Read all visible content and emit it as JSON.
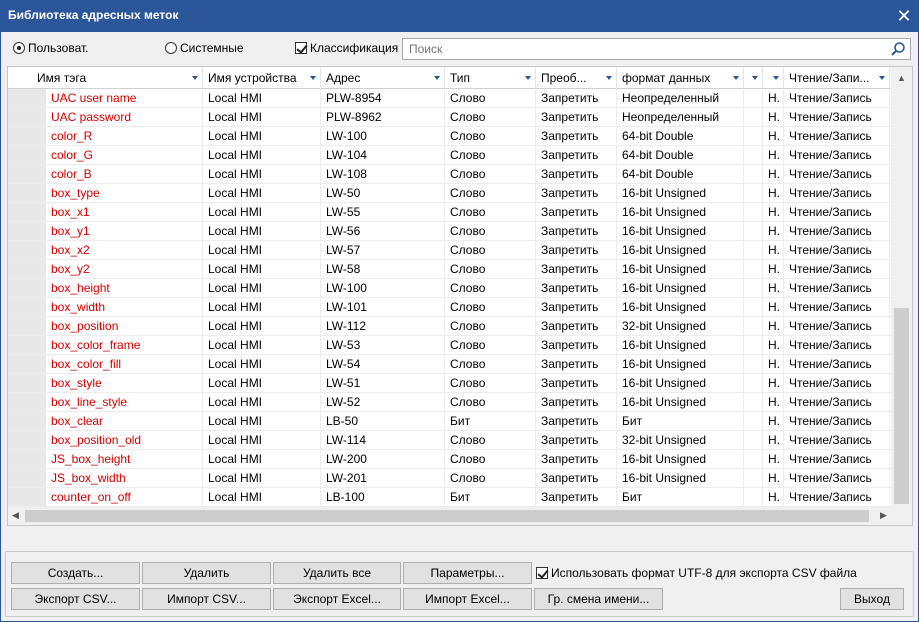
{
  "window": {
    "title": "Библиотека адресных меток",
    "close_glyph": "✕"
  },
  "filters": {
    "user_label": "Пользоват.",
    "system_label": "Системные",
    "classification_label": "Классификация",
    "user_selected": true,
    "classification_checked": true,
    "search_placeholder": "Поиск"
  },
  "table": {
    "columns": [
      "Имя тэга",
      "Имя устройства",
      "Адрес",
      "Тип",
      "Преоб...",
      "формат данных",
      "",
      "",
      "Чтение/Запи..."
    ],
    "rows": [
      [
        "UAC user name",
        "Local HMI",
        "PLW-8954",
        "Слово",
        "Запретить",
        "Неопределенный",
        "",
        "Н.",
        "Чтение/Запись"
      ],
      [
        "UAC password",
        "Local HMI",
        "PLW-8962",
        "Слово",
        "Запретить",
        "Неопределенный",
        "",
        "Н.",
        "Чтение/Запись"
      ],
      [
        "color_R",
        "Local HMI",
        "LW-100",
        "Слово",
        "Запретить",
        "64-bit Double",
        "",
        "Н.",
        "Чтение/Запись"
      ],
      [
        "color_G",
        "Local HMI",
        "LW-104",
        "Слово",
        "Запретить",
        "64-bit Double",
        "",
        "Н.",
        "Чтение/Запись"
      ],
      [
        "color_B",
        "Local HMI",
        "LW-108",
        "Слово",
        "Запретить",
        "64-bit Double",
        "",
        "Н.",
        "Чтение/Запись"
      ],
      [
        "box_type",
        "Local HMI",
        "LW-50",
        "Слово",
        "Запретить",
        "16-bit Unsigned",
        "",
        "Н.",
        "Чтение/Запись"
      ],
      [
        "box_x1",
        "Local HMI",
        "LW-55",
        "Слово",
        "Запретить",
        "16-bit Unsigned",
        "",
        "Н.",
        "Чтение/Запись"
      ],
      [
        "box_y1",
        "Local HMI",
        "LW-56",
        "Слово",
        "Запретить",
        "16-bit Unsigned",
        "",
        "Н.",
        "Чтение/Запись"
      ],
      [
        "box_x2",
        "Local HMI",
        "LW-57",
        "Слово",
        "Запретить",
        "16-bit Unsigned",
        "",
        "Н.",
        "Чтение/Запись"
      ],
      [
        "box_y2",
        "Local HMI",
        "LW-58",
        "Слово",
        "Запретить",
        "16-bit Unsigned",
        "",
        "Н.",
        "Чтение/Запись"
      ],
      [
        "box_height",
        "Local HMI",
        "LW-100",
        "Слово",
        "Запретить",
        "16-bit Unsigned",
        "",
        "Н.",
        "Чтение/Запись"
      ],
      [
        "box_width",
        "Local HMI",
        "LW-101",
        "Слово",
        "Запретить",
        "16-bit Unsigned",
        "",
        "Н.",
        "Чтение/Запись"
      ],
      [
        "box_position",
        "Local HMI",
        "LW-112",
        "Слово",
        "Запретить",
        "32-bit Unsigned",
        "",
        "Н.",
        "Чтение/Запись"
      ],
      [
        "box_color_frame",
        "Local HMI",
        "LW-53",
        "Слово",
        "Запретить",
        "16-bit Unsigned",
        "",
        "Н.",
        "Чтение/Запись"
      ],
      [
        "box_color_fill",
        "Local HMI",
        "LW-54",
        "Слово",
        "Запретить",
        "16-bit Unsigned",
        "",
        "Н.",
        "Чтение/Запись"
      ],
      [
        "box_style",
        "Local HMI",
        "LW-51",
        "Слово",
        "Запретить",
        "16-bit Unsigned",
        "",
        "Н.",
        "Чтение/Запись"
      ],
      [
        "box_line_style",
        "Local HMI",
        "LW-52",
        "Слово",
        "Запретить",
        "16-bit Unsigned",
        "",
        "Н.",
        "Чтение/Запись"
      ],
      [
        "box_clear",
        "Local HMI",
        "LB-50",
        "Бит",
        "Запретить",
        "Бит",
        "",
        "Н.",
        "Чтение/Запись"
      ],
      [
        "box_position_old",
        "Local HMI",
        "LW-114",
        "Слово",
        "Запретить",
        "32-bit Unsigned",
        "",
        "Н.",
        "Чтение/Запись"
      ],
      [
        "JS_box_height",
        "Local HMI",
        "LW-200",
        "Слово",
        "Запретить",
        "16-bit Unsigned",
        "",
        "Н.",
        "Чтение/Запись"
      ],
      [
        "JS_box_width",
        "Local HMI",
        "LW-201",
        "Слово",
        "Запретить",
        "16-bit Unsigned",
        "",
        "Н.",
        "Чтение/Запись"
      ],
      [
        "counter_on_off",
        "Local HMI",
        "LB-100",
        "Бит",
        "Запретить",
        "Бит",
        "",
        "Н.",
        "Чтение/Запись"
      ]
    ]
  },
  "buttons": {
    "create": "Создать...",
    "delete": "Удалить",
    "delete_all": "Удалить все",
    "params": "Параметры...",
    "export_csv": "Экспорт CSV...",
    "import_csv": "Импорт CSV...",
    "export_excel": "Экспорт Excel...",
    "import_excel": "Импорт Excel...",
    "rename_group": "Гр. смена имени...",
    "exit": "Выход"
  },
  "utf8": {
    "label": "Использовать формат UTF-8 для экспорта CSV файла",
    "checked": true
  },
  "colors": {
    "title_bar": "#2b579a",
    "tag_text": "#d00000"
  },
  "icons": {
    "search": "magnifier-icon",
    "close": "close-icon"
  }
}
